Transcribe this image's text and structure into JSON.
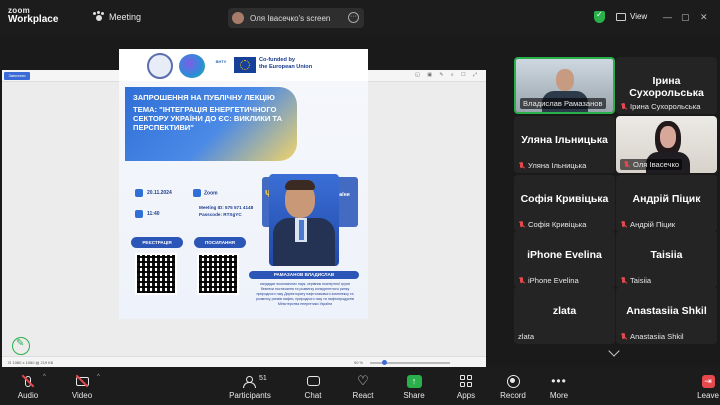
{
  "app": {
    "logo_line1": "zoom",
    "logo_line2": "Workplace",
    "meeting_label": "Meeting"
  },
  "screen_share": {
    "owner_label": "Оля Івасечко's screen",
    "more_glyph": "···"
  },
  "view": {
    "label": "View"
  },
  "window_controls": {
    "minimize": "—",
    "maximize": "▢",
    "close": "✕"
  },
  "viewer": {
    "toolbar_btn": "Запитати",
    "file_name": "465776582_539219086917937_518694128534840747 n.jpg",
    "toolbar_icons": "◱ ▣ ✎ ⌕ ☐ ⤢",
    "dims": "⊡ 1080 x 1080   ▤ 219 КБ",
    "zoom": "90 %"
  },
  "poster": {
    "logo3_text": "ВНТУ",
    "cofunded": "Co-funded by\nthe European Union",
    "heading": "ЗАПРОШЕННЯ НА ПУБЛІЧНУ ЛЕКЦІЮ",
    "topic": "ТЕМА: \"ІНТЕГРАЦІЯ ЕНЕРГЕТИЧНОГО СЕКТОРУ УКРАЇНИ ДО ЄС: ВИКЛИКИ ТА ПЕРСПЕКТИВИ\"",
    "date": "20.11.2024",
    "time": "11:40",
    "platform": "Zoom",
    "meeting_id": "Meeting ID: 575 571 4148",
    "passcode": "Passcode: RTXgYC",
    "register_btn": "РЕЄСТРАЦІЯ",
    "link_btn": "ПОСИЛАННЯ",
    "ministry": "Міністерство енергетики України",
    "speaker": "РАМАЗАНОВ ВЛАДИСЛАВ",
    "speaker_desc": "кандидат економічних наук, керівник експертної групи безпеки постачання та розвитку конкурентного ринку природного газу Директорату нафтогазового комплексу та розвитку ринків нафти, природного газу та нафтопродуктів Міністерства енергетики України"
  },
  "participants": [
    {
      "display": "",
      "label": "Владислав Рамазанов",
      "muted": false,
      "video": true,
      "active": true
    },
    {
      "display": "Ірина Сухорольська",
      "label": "Ірина Сухорольська",
      "muted": true,
      "video": false,
      "active": false
    },
    {
      "display": "Уляна Ільницька",
      "label": "Уляна Ільницька",
      "muted": true,
      "video": false,
      "active": false
    },
    {
      "display": "",
      "label": "Оля Івасечко",
      "muted": true,
      "video": true,
      "active": false
    },
    {
      "display": "Софія Кривіцька",
      "label": "Софія Кривіцька",
      "muted": true,
      "video": false,
      "active": false
    },
    {
      "display": "Андрій Піцик",
      "label": "Андрій Піцик",
      "muted": true,
      "video": false,
      "active": false
    },
    {
      "display": "iPhone Evelina",
      "label": "iPhone Evelina",
      "muted": true,
      "video": false,
      "active": false
    },
    {
      "display": "Taisiia",
      "label": "Taisiia",
      "muted": true,
      "video": false,
      "active": false
    },
    {
      "display": "zlata",
      "label": "zlata",
      "muted": false,
      "video": false,
      "active": false
    },
    {
      "display": "Anastasiia Shkil",
      "label": "Anastasiia Shkil",
      "muted": true,
      "video": false,
      "active": false
    }
  ],
  "toolbar": {
    "audio": "Audio",
    "video": "Video",
    "participants": "Participants",
    "participants_count": "51",
    "chat": "Chat",
    "react": "React",
    "share": "Share",
    "apps": "Apps",
    "record": "Record",
    "more": "More",
    "leave": "Leave"
  },
  "colors": {
    "accent_green": "#2ab04a",
    "mute_red": "#e5484d",
    "background": "#1a1a1a"
  }
}
